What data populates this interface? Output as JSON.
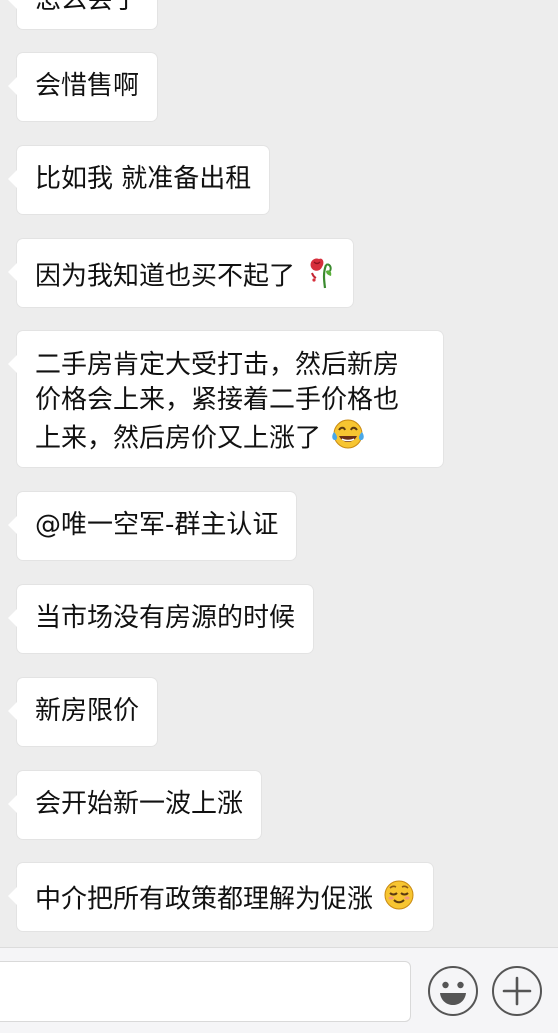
{
  "messages": [
    {
      "text": "怎么会了"
    },
    {
      "text": "会惜售啊"
    },
    {
      "text": "比如我 就准备出租"
    },
    {
      "text": "因为我知道也买不起了",
      "emoji": "wilted-rose-emoji"
    },
    {
      "lines": [
        "二手房肯定大受打击，然后新房",
        "价格会上来，紧接着二手价格也",
        "上来，然后房价又上涨了"
      ],
      "emoji": "crying-laughing-face-emoji"
    },
    {
      "text": "@唯一空军-群主认证"
    },
    {
      "text": "当市场没有房源的时候"
    },
    {
      "text": "新房限价"
    },
    {
      "text": "会开始新一波上涨"
    },
    {
      "text": "中介把所有政策都理解为促涨",
      "emoji": "relieved-face-emoji"
    }
  ],
  "input_bar": {
    "input_value": "",
    "buttons": [
      "emoji-button",
      "add-button"
    ]
  },
  "colors": {
    "background": "#ededed",
    "bubble": "#ffffff",
    "input_bar": "#f5f5f7"
  }
}
